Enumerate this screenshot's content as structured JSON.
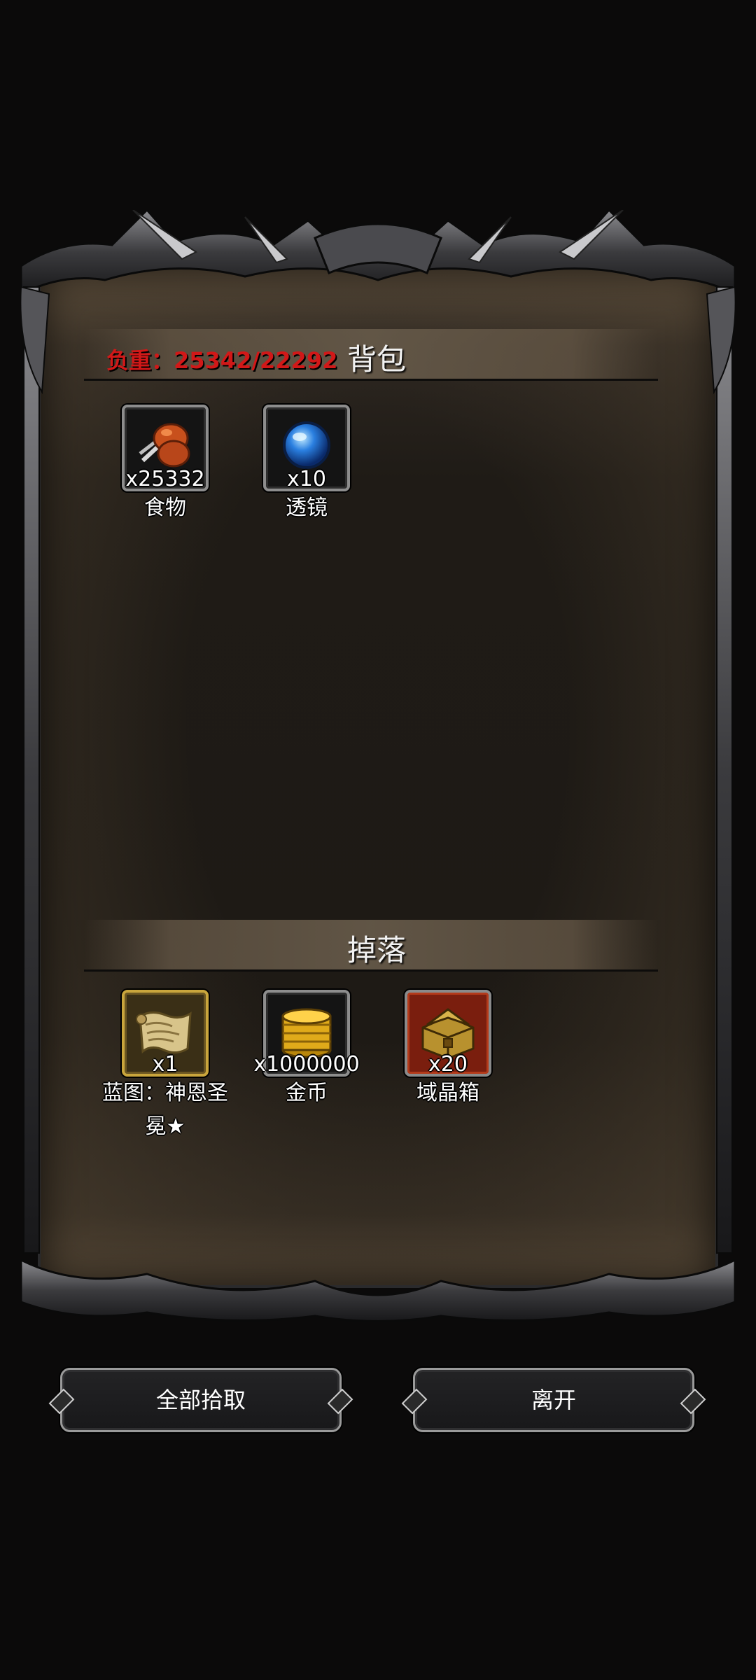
{
  "bag": {
    "weight_label": "负重：25342/22292",
    "title": "背包",
    "items": [
      {
        "name": "食物",
        "qty": "x25332",
        "icon": "food-drumstick-icon"
      },
      {
        "name": "透镜",
        "qty": "x10",
        "icon": "blue-lens-icon"
      }
    ]
  },
  "drops": {
    "title": "掉落",
    "items": [
      {
        "name": "蓝图：神恩圣冕★",
        "qty": "x1",
        "icon": "blueprint-scroll-icon"
      },
      {
        "name": "金币",
        "qty": "x1000000",
        "icon": "gold-coins-icon"
      },
      {
        "name": "域晶箱",
        "qty": "x20",
        "icon": "crystal-chest-icon"
      }
    ]
  },
  "buttons": {
    "pickup_all": "全部拾取",
    "leave": "离开"
  },
  "colors": {
    "weight_overloaded": "#d11818",
    "background": "#0b0a0a",
    "panel": "#1f1b16"
  }
}
